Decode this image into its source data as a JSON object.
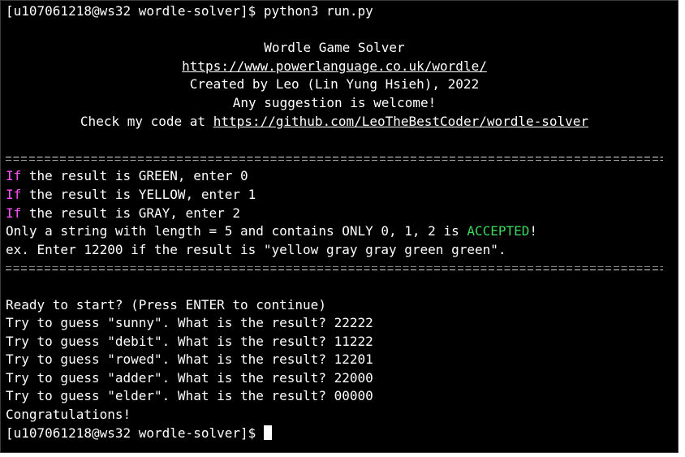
{
  "prompt": {
    "user_host": "[u107061218@ws32 wordle-solver]$",
    "command": "python3 run.py"
  },
  "banner": {
    "title": "Wordle Game Solver",
    "url": "https://www.powerlanguage.co.uk/wordle/",
    "credit": "Created by Leo (Lin Yung Hsieh), 2022",
    "suggestion": "Any suggestion is welcome!",
    "code_prefix": "Check my code at ",
    "code_url": "https://github.com/LeoTheBestCoder/wordle-solver"
  },
  "instructions": {
    "if_word": "If",
    "rule_green": " the result is GREEN, enter 0",
    "rule_yellow": " the result is YELLOW, enter 1",
    "rule_gray": " the result is GRAY, enter 2",
    "accept_prefix": "Only a string with length = 5 and contains ONLY 0, 1, 2 is ",
    "accept_word": "ACCEPTED",
    "accept_suffix": "!",
    "example": "ex. Enter 12200 if the result is \"yellow gray gray green green\"."
  },
  "session": {
    "ready": "Ready to start? (Press ENTER to continue)",
    "guesses": [
      "Try to guess \"sunny\". What is the result? 22222",
      "Try to guess \"debit\". What is the result? 11222",
      "Try to guess \"rowed\". What is the result? 12201",
      "Try to guess \"adder\". What is the result? 22000",
      "Try to guess \"elder\". What is the result? 00000"
    ],
    "done": "Congratulations!"
  },
  "colors": {
    "background": "#000000",
    "text": "#ffffff",
    "if_keyword": "#ff4fff",
    "accepted": "#3ad95c"
  }
}
